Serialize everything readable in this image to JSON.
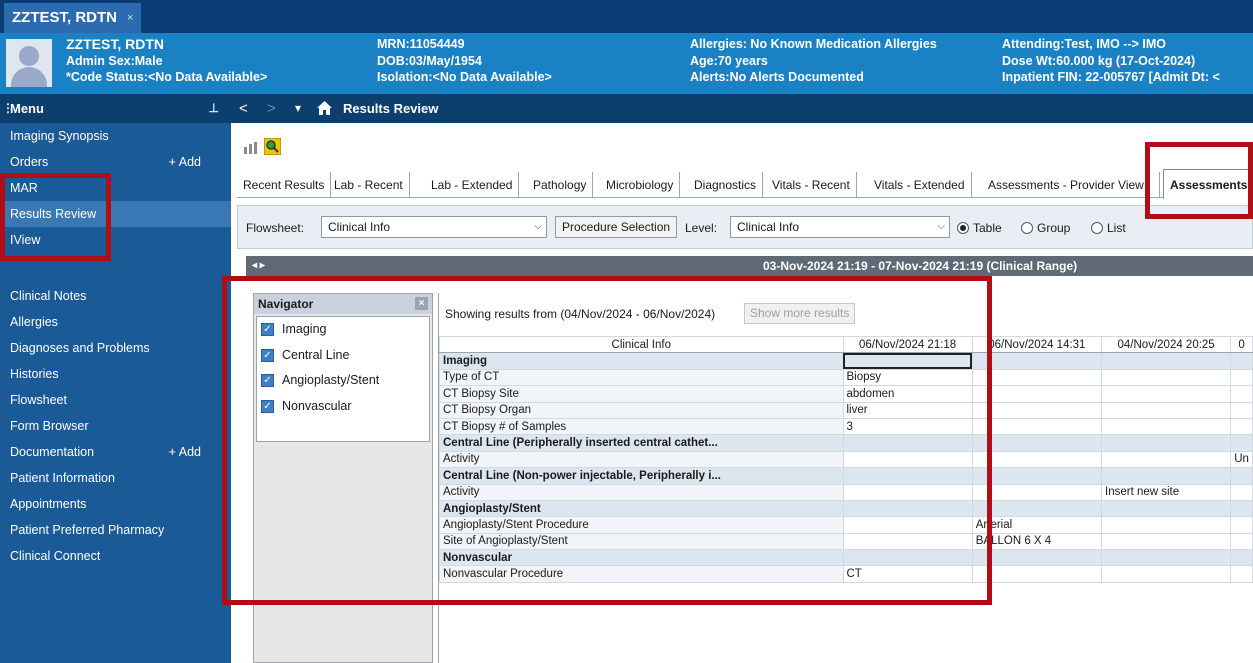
{
  "tab": {
    "patient_label": "ZZTEST, RDTN",
    "close": "×"
  },
  "banner": {
    "name": "ZZTEST, RDTN",
    "sex": "Admin Sex:Male",
    "code_status": "*Code Status:<No Data Available>",
    "mrn": "MRN:11054449",
    "dob": "DOB:03/May/1954",
    "isolation": "Isolation:<No Data Available>",
    "allergies": "Allergies: No Known Medication Allergies",
    "age": "Age:70 years",
    "alerts": "Alerts:No Alerts Documented",
    "attending": "Attending:Test, IMO --> IMO",
    "dose_wt": "Dose Wt:60.000 kg (17-Oct-2024)",
    "fin": "Inpatient FIN: 22-005767 [Admit Dt: <"
  },
  "menu": {
    "header": "Menu",
    "items": [
      {
        "label": "Imaging Synopsis"
      },
      {
        "label": "Orders",
        "add": "+ Add"
      },
      {
        "label": "MAR"
      },
      {
        "label": "Results Review"
      },
      {
        "label": "IView"
      },
      {
        "label": "Clinical Notes"
      },
      {
        "label": "Allergies"
      },
      {
        "label": "Diagnoses and Problems"
      },
      {
        "label": "Histories"
      },
      {
        "label": "Flowsheet"
      },
      {
        "label": "Form Browser"
      },
      {
        "label": "Documentation",
        "add": "+ Add"
      },
      {
        "label": "Patient Information"
      },
      {
        "label": "Appointments"
      },
      {
        "label": "Patient Preferred Pharmacy"
      },
      {
        "label": "Clinical Connect"
      }
    ]
  },
  "toolbar": {
    "back": "<",
    "forward": ">",
    "dropdown": "▾",
    "home_icon": "home-icon",
    "title": "Results Review"
  },
  "result_tabs": [
    "Recent Results",
    "Lab - Recent",
    "Lab - Extended",
    "Pathology",
    "Microbiology",
    "Diagnostics",
    "Vitals - Recent",
    "Vitals - Extended",
    "Assessments - Provider View",
    "Assessments"
  ],
  "filter": {
    "flowsheet_label": "Flowsheet:",
    "flowsheet_value": "Clinical Info",
    "procedure_button": "Procedure Selection",
    "level_label": "Level:",
    "level_value": "Clinical Info",
    "views": [
      "Table",
      "Group",
      "List"
    ],
    "selected_view": "Table"
  },
  "range_bar": {
    "arrows": "◂ ▸",
    "text": "03-Nov-2024 21:19 - 07-Nov-2024 21:19 (Clinical Range)"
  },
  "navigator": {
    "title": "Navigator",
    "close": "×",
    "items": [
      "Imaging",
      "Central Line",
      "Angioplasty/Stent",
      "Nonvascular"
    ]
  },
  "results": {
    "showing": "Showing results from (04/Nov/2024 - 06/Nov/2024)",
    "more_button": "Show more results",
    "columns": [
      "Clinical Info",
      "06/Nov/2024 21:18",
      "06/Nov/2024 14:31",
      "04/Nov/2024 20:25",
      "0"
    ],
    "rows": [
      {
        "section": true,
        "label": "Imaging",
        "cells": [
          "",
          "",
          "",
          ""
        ]
      },
      {
        "label": "Type of CT",
        "cells": [
          "Biopsy",
          "",
          "",
          ""
        ]
      },
      {
        "label": "CT Biopsy Site",
        "cells": [
          "abdomen",
          "",
          "",
          ""
        ]
      },
      {
        "label": "CT Biopsy Organ",
        "cells": [
          "liver",
          "",
          "",
          ""
        ]
      },
      {
        "label": "CT Biopsy # of Samples",
        "cells": [
          "3",
          "",
          "",
          ""
        ]
      },
      {
        "section": true,
        "label": "Central Line (Peripherally inserted central cathet...",
        "cells": [
          "",
          "",
          "",
          ""
        ]
      },
      {
        "label": "Activity",
        "cells": [
          "",
          "",
          "",
          "Un"
        ]
      },
      {
        "section": true,
        "label": "Central Line (Non-power injectable, Peripherally i...",
        "cells": [
          "",
          "",
          "",
          ""
        ]
      },
      {
        "label": "Activity",
        "cells": [
          "",
          "",
          "Insert new site",
          ""
        ]
      },
      {
        "section": true,
        "label": "Angioplasty/Stent",
        "cells": [
          "",
          "",
          "",
          ""
        ]
      },
      {
        "label": "Angioplasty/Stent Procedure",
        "cells": [
          "",
          "Arterial",
          "",
          ""
        ]
      },
      {
        "label": "Site of Angioplasty/Stent",
        "cells": [
          "",
          "BALLON 6 X 4",
          "",
          ""
        ]
      },
      {
        "section": true,
        "label": "Nonvascular",
        "cells": [
          "",
          "",
          "",
          ""
        ]
      },
      {
        "label": "Nonvascular Procedure",
        "cells": [
          "CT",
          "",
          "",
          ""
        ]
      }
    ]
  },
  "colors": {
    "banner": "#1a82c4",
    "menu": "#1a5a96",
    "toolbar": "#0d3f6e",
    "highlight": "#b00d16"
  }
}
